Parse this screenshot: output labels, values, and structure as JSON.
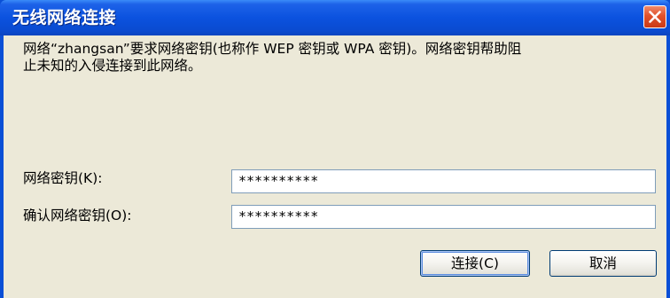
{
  "dialog": {
    "title": "无线网络连接",
    "message_line1": "网络“zhangsan”要求网络密钥(也称作 WEP 密钥或 WPA 密钥)。网络密钥帮助阻",
    "message_line2": "止未知的入侵连接到此网络。",
    "key_label": "网络密钥(K):",
    "key_value": "**********",
    "confirm_label": "确认网络密钥(O):",
    "confirm_value": "**********",
    "connect_button": "连接(C)",
    "cancel_button": "取消"
  },
  "icons": {
    "close": "close-icon"
  },
  "colors": {
    "titlebar": "#0a52df",
    "client_bg": "#ece9d8",
    "close_button": "#e0512b",
    "field_border": "#7f9db9"
  }
}
